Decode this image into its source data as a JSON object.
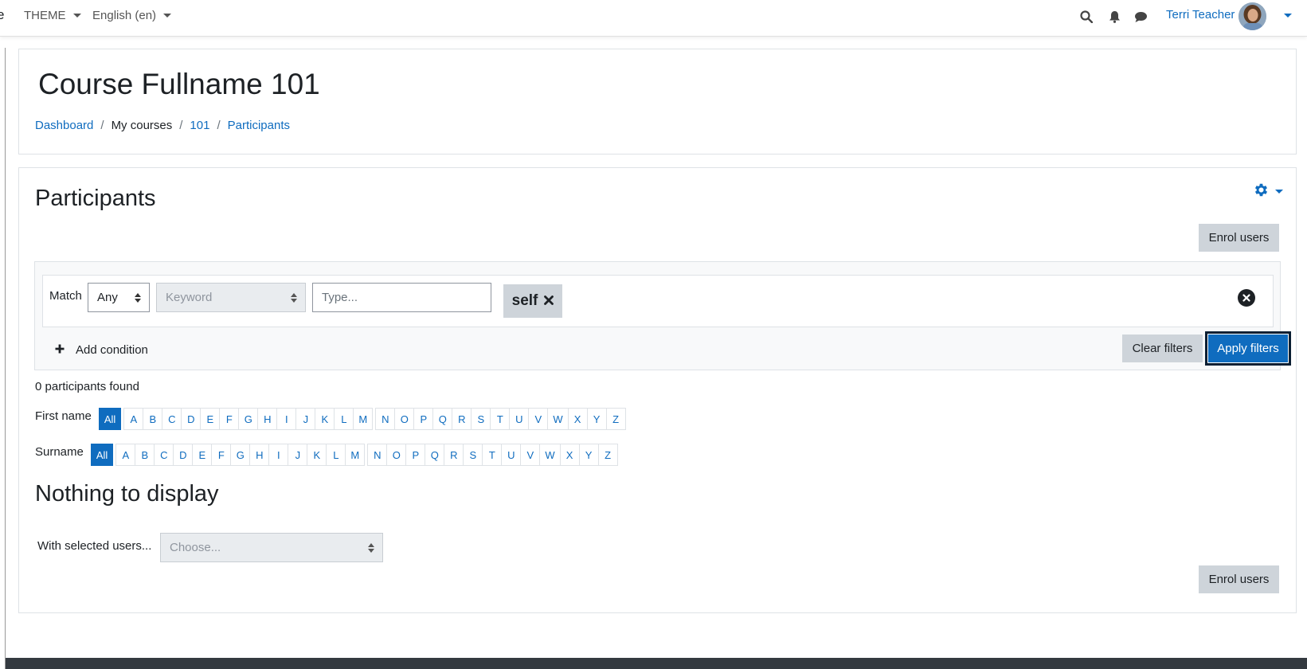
{
  "topnav": {
    "brand_fragment": "e",
    "theme_label": "THEME",
    "language_label": "English (en)",
    "user_name": "Terri Teacher"
  },
  "header": {
    "course_title": "Course Fullname 101",
    "breadcrumb": {
      "dashboard": "Dashboard",
      "my_courses": "My courses",
      "course": "101",
      "participants": "Participants"
    }
  },
  "main": {
    "heading": "Participants",
    "enrol_button_top": "Enrol users",
    "enrol_button_bottom": "Enrol users",
    "filter": {
      "match_label": "Match",
      "match_value": "Any",
      "keyword_value": "Keyword",
      "type_placeholder": "Type...",
      "tag_label": "self",
      "add_condition": "Add condition",
      "clear_filters": "Clear filters",
      "apply_filters": "Apply filters"
    },
    "participants_found": "0 participants found",
    "firstname_label": "First name",
    "surname_label": "Surname",
    "initials_all": "All",
    "initials_letters": [
      "A",
      "B",
      "C",
      "D",
      "E",
      "F",
      "G",
      "H",
      "I",
      "J",
      "K",
      "L",
      "M",
      "N",
      "O",
      "P",
      "Q",
      "R",
      "S",
      "T",
      "U",
      "V",
      "W",
      "X",
      "Y",
      "Z"
    ],
    "nothing_to_display": "Nothing to display",
    "with_selected_label": "With selected users...",
    "with_selected_value": "Choose..."
  },
  "colors": {
    "primary": "#0f6cbf",
    "secondary_button": "#ced4da",
    "footer": "#343a40"
  }
}
